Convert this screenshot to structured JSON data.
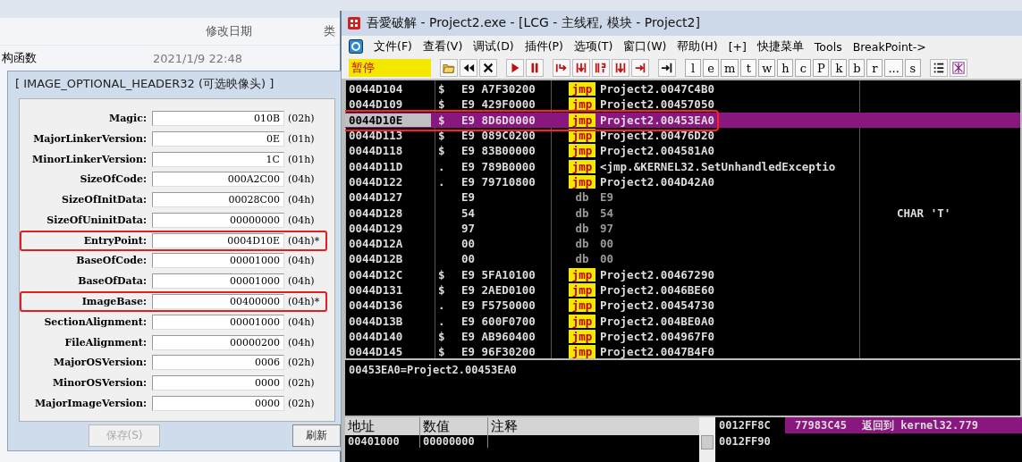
{
  "explorer": {
    "column_header": "修改日期",
    "column_header_2": "类",
    "file_name": "构函数",
    "file_date": "2021/1/9 22:48"
  },
  "pe_dialog": {
    "title": "[ IMAGE_OPTIONAL_HEADER32 (可选映像头) ]",
    "fields": [
      {
        "label": "Magic:",
        "value": "010B",
        "size": "(02h)",
        "highlighted": false
      },
      {
        "label": "MajorLinkerVersion:",
        "value": "0E",
        "size": "(01h)",
        "highlighted": false
      },
      {
        "label": "MinorLinkerVersion:",
        "value": "1C",
        "size": "(01h)",
        "highlighted": false
      },
      {
        "label": "SizeOfCode:",
        "value": "000A2C00",
        "size": "(04h)",
        "highlighted": false
      },
      {
        "label": "SizeOfInitData:",
        "value": "00028C00",
        "size": "(04h)",
        "highlighted": false
      },
      {
        "label": "SizeOfUninitData:",
        "value": "00000000",
        "size": "(04h)",
        "highlighted": false
      },
      {
        "label": "EntryPoint:",
        "value": "0004D10E",
        "size": "(04h)*",
        "highlighted": true
      },
      {
        "label": "BaseOfCode:",
        "value": "00001000",
        "size": "(04h)",
        "highlighted": false
      },
      {
        "label": "BaseOfData:",
        "value": "00001000",
        "size": "(04h)",
        "highlighted": false
      },
      {
        "label": "ImageBase:",
        "value": "00400000",
        "size": "(04h)*",
        "highlighted": true
      },
      {
        "label": "SectionAlignment:",
        "value": "00001000",
        "size": "(04h)",
        "highlighted": false
      },
      {
        "label": "FileAlignment:",
        "value": "00000200",
        "size": "(04h)",
        "highlighted": false
      },
      {
        "label": "MajorOSVersion:",
        "value": "0006",
        "size": "(02h)",
        "highlighted": false
      },
      {
        "label": "MinorOSVersion:",
        "value": "0000",
        "size": "(02h)",
        "highlighted": false
      },
      {
        "label": "MajorImageVersion:",
        "value": "0000",
        "size": "(02h)",
        "highlighted": false
      }
    ],
    "buttons": [
      {
        "label": "保存(S)",
        "disabled": true
      },
      {
        "label": "刷新",
        "disabled": false
      }
    ]
  },
  "debugger": {
    "title": "吾愛破解 - Project2.exe - [LCG -  主线程, 模块 - Project2]",
    "menu": [
      "文件(F)",
      "查看(V)",
      "调试(D)",
      "插件(P)",
      "选项(T)",
      "窗口(W)",
      "帮助(H)",
      "[+]",
      "快捷菜单",
      "Tools",
      "BreakPoint->"
    ],
    "status": "暂停",
    "letter_buttons": [
      "l",
      "e",
      "m",
      "t",
      "w",
      "h",
      "c",
      "P",
      "k",
      "b",
      "r",
      "...",
      "s"
    ],
    "disassembly": [
      {
        "address": "0044D104",
        "marker": "$",
        "bytes": "E9 A7F30200",
        "kind": "jmp",
        "mnemonic": "jmp",
        "operand": "Project2.0047C4B0",
        "selected": false
      },
      {
        "address": "0044D109",
        "marker": "$",
        "bytes": "E9 429F0000",
        "kind": "jmp",
        "mnemonic": "jmp",
        "operand": "Project2.00457050",
        "selected": false
      },
      {
        "address": "0044D10E",
        "marker": "$",
        "bytes": "E9 8D6D0000",
        "kind": "jmp",
        "mnemonic": "jmp",
        "operand": "Project2.00453EA0",
        "selected": true
      },
      {
        "address": "0044D113",
        "marker": "$",
        "bytes": "E9 089C0200",
        "kind": "jmp",
        "mnemonic": "jmp",
        "operand": "Project2.00476D20",
        "selected": false
      },
      {
        "address": "0044D118",
        "marker": "$",
        "bytes": "E9 83B00000",
        "kind": "jmp",
        "mnemonic": "jmp",
        "operand": "Project2.004581A0",
        "selected": false
      },
      {
        "address": "0044D11D",
        "marker": ".",
        "bytes": "E9 789B0000",
        "kind": "jmp",
        "mnemonic": "jmp",
        "operand": "<jmp.&KERNEL32.SetUnhandledExceptio",
        "selected": false
      },
      {
        "address": "0044D122",
        "marker": ".",
        "bytes": "E9 79710800",
        "kind": "jmp",
        "mnemonic": "jmp",
        "operand": "Project2.004D42A0",
        "selected": false
      },
      {
        "address": "0044D127",
        "bytes": "E9",
        "kind": "db",
        "mnemonic": "db",
        "operand": "E9",
        "selected": false
      },
      {
        "address": "0044D128",
        "bytes": "54",
        "kind": "db",
        "mnemonic": "db",
        "operand": "54",
        "comment": "CHAR 'T'",
        "selected": false
      },
      {
        "address": "0044D129",
        "bytes": "97",
        "kind": "db",
        "mnemonic": "db",
        "operand": "97",
        "selected": false
      },
      {
        "address": "0044D12A",
        "bytes": "00",
        "kind": "db",
        "mnemonic": "db",
        "operand": "00",
        "selected": false
      },
      {
        "address": "0044D12B",
        "bytes": "00",
        "kind": "db",
        "mnemonic": "db",
        "operand": "00",
        "selected": false
      },
      {
        "address": "0044D12C",
        "marker": "$",
        "bytes": "E9 5FA10100",
        "kind": "jmp",
        "mnemonic": "jmp",
        "operand": "Project2.00467290",
        "selected": false
      },
      {
        "address": "0044D131",
        "marker": "$",
        "bytes": "E9 2AED0100",
        "kind": "jmp",
        "mnemonic": "jmp",
        "operand": "Project2.0046BE60",
        "selected": false
      },
      {
        "address": "0044D136",
        "marker": ".",
        "bytes": "E9 F5750000",
        "kind": "jmp",
        "mnemonic": "jmp",
        "operand": "Project2.00454730",
        "selected": false
      },
      {
        "address": "0044D13B",
        "marker": ".",
        "bytes": "E9 600F0700",
        "kind": "jmp",
        "mnemonic": "jmp",
        "operand": "Project2.004BE0A0",
        "selected": false
      },
      {
        "address": "0044D140",
        "marker": "$",
        "bytes": "E9 AB960400",
        "kind": "jmp",
        "mnemonic": "jmp",
        "operand": "Project2.004967F0",
        "selected": false
      },
      {
        "address": "0044D145",
        "marker": "$",
        "bytes": "E9 96F30200",
        "kind": "jmp",
        "mnemonic": "jmp",
        "operand": "Project2.0047B4F0",
        "selected": false
      }
    ],
    "info_line": "00453EA0=Project2.00453EA0",
    "dump": {
      "columns": [
        "地址",
        "数值",
        "注释"
      ],
      "rows": [
        {
          "address": "00401000",
          "value": "00000000"
        }
      ]
    },
    "stack": [
      {
        "address": "0012FF8C",
        "value": "77983C45",
        "comment": "返回到 kernel32.779",
        "selected": true
      },
      {
        "address": "0012FF90",
        "selected": false
      }
    ]
  }
}
